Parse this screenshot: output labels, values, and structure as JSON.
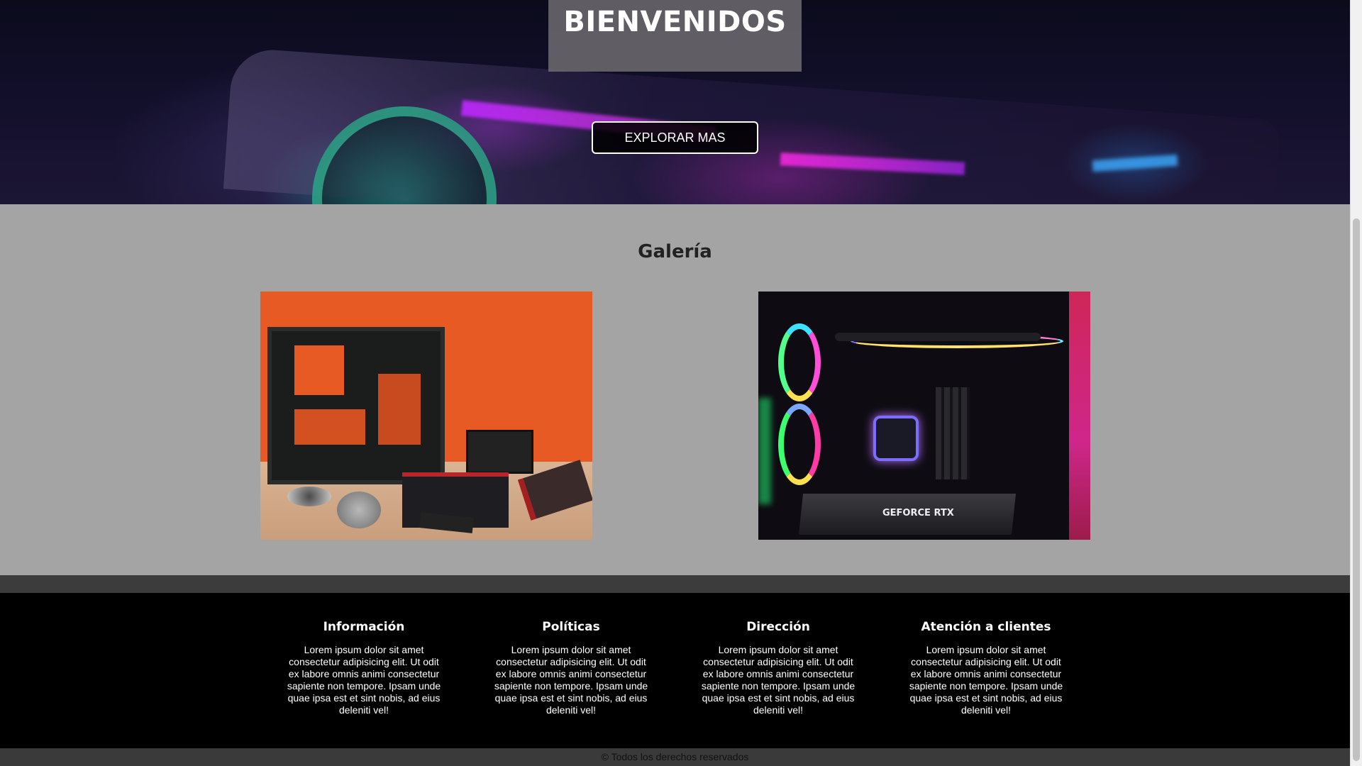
{
  "hero": {
    "title": "BIENVENIDOS",
    "button_label": "EXPLORAR MAS"
  },
  "gallery": {
    "title": "Galería",
    "images": [
      {
        "name": "pc-parts-image"
      },
      {
        "name": "rgb-pc-build-image",
        "visible_text": "GEFORCE RTX"
      }
    ]
  },
  "footer": {
    "columns": [
      {
        "title": "Información",
        "text": "Lorem ipsum dolor sit amet consectetur adipisicing elit. Ut odit ex labore omnis animi consectetur sapiente non tempore. Ipsam unde quae ipsa est et sint nobis, ad eius deleniti vel!"
      },
      {
        "title": "Políticas",
        "text": "Lorem ipsum dolor sit amet consectetur adipisicing elit. Ut odit ex labore omnis animi consectetur sapiente non tempore. Ipsam unde quae ipsa est et sint nobis, ad eius deleniti vel!"
      },
      {
        "title": "Dirección",
        "text": "Lorem ipsum dolor sit amet consectetur adipisicing elit. Ut odit ex labore omnis animi consectetur sapiente non tempore. Ipsam unde quae ipsa est et sint nobis, ad eius deleniti vel!"
      },
      {
        "title": "Atención a clientes",
        "text": "Lorem ipsum dolor sit amet consectetur adipisicing elit. Ut odit ex labore omnis animi consectetur sapiente non tempore. Ipsam unde quae ipsa est et sint nobis, ad eius deleniti vel!"
      }
    ],
    "copyright": "© Todos los derechos reservados"
  },
  "colors": {
    "gallery_bg": "#a4a4a4",
    "footer_bg": "#000000",
    "divider_bg": "#3c3c3c",
    "hero_box_bg": "#6e6c70"
  }
}
